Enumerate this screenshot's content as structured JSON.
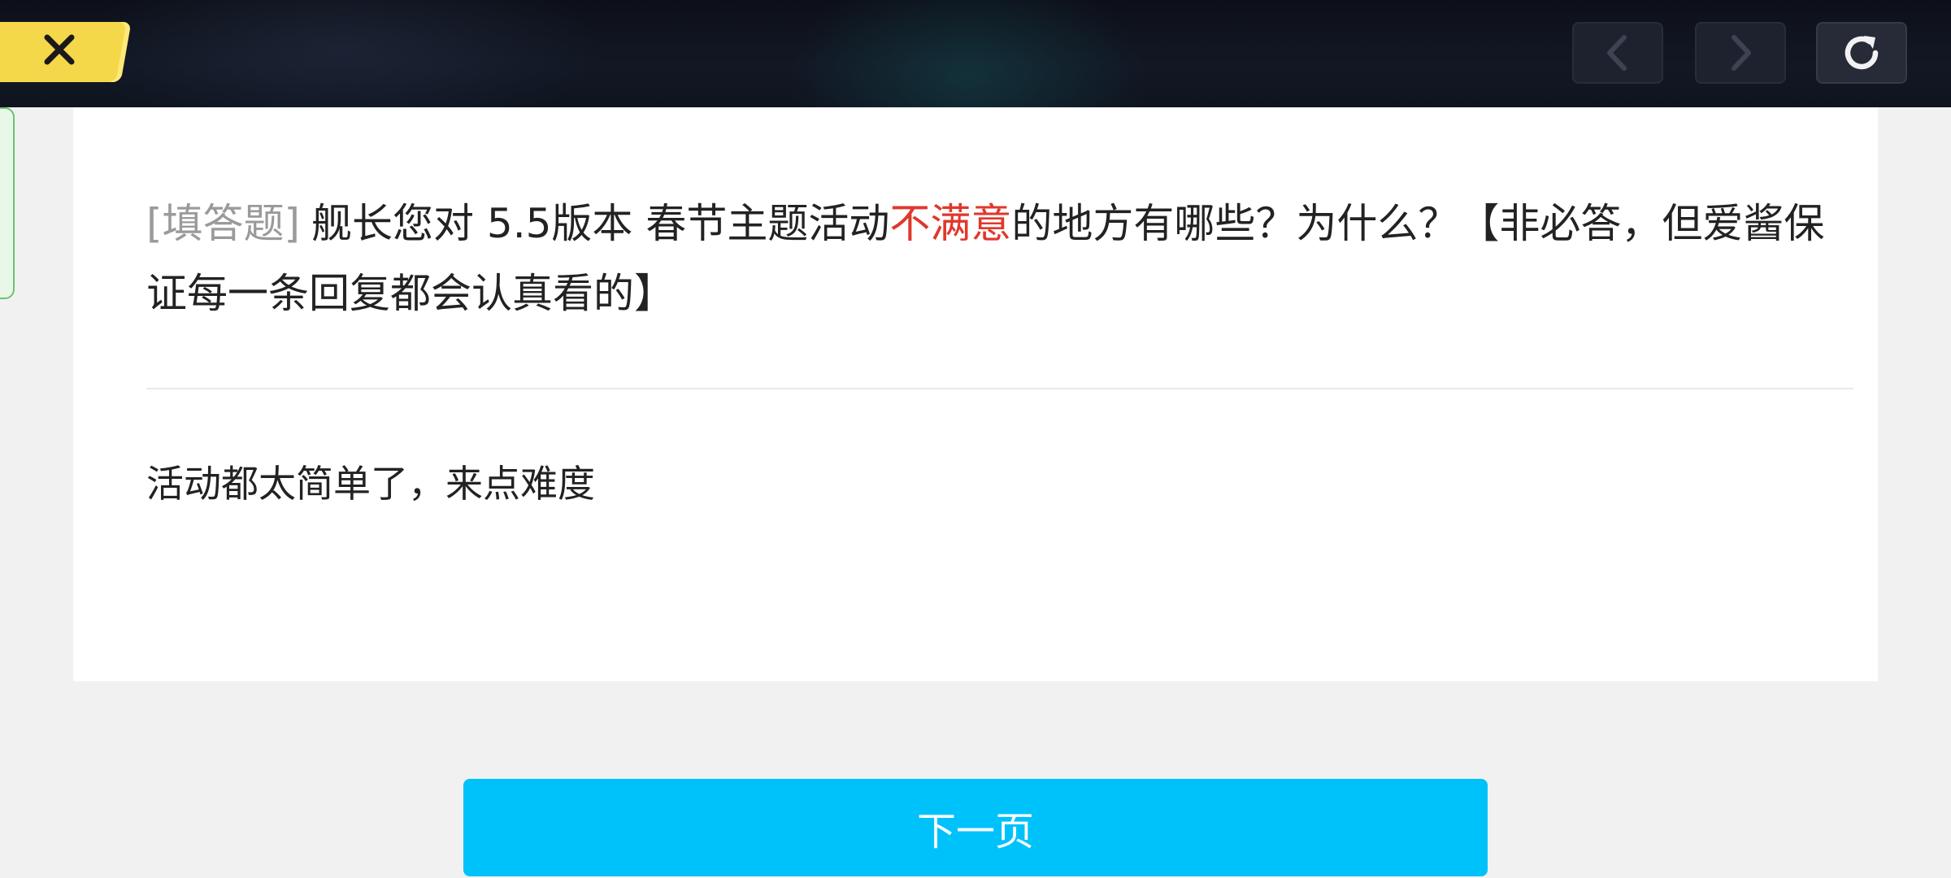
{
  "toolbar": {
    "close_icon": "close-icon",
    "back_icon": "chevron-left-icon",
    "forward_icon": "chevron-right-icon",
    "refresh_icon": "refresh-icon",
    "close_tab_color": "#f4d84a"
  },
  "question": {
    "type_label": "[填答题]",
    "text_before": "舰长您对 5.5版本 春节主题活动",
    "highlight": "不满意",
    "text_after": "的地方有哪些？为什么？【非必答，但爱酱保证每一条回复都会认真看的】",
    "highlight_color": "#e0372c"
  },
  "answer": {
    "value": "活动都太简单了，来点难度"
  },
  "next_button": {
    "label": "下一页",
    "color": "#00c2fb"
  }
}
